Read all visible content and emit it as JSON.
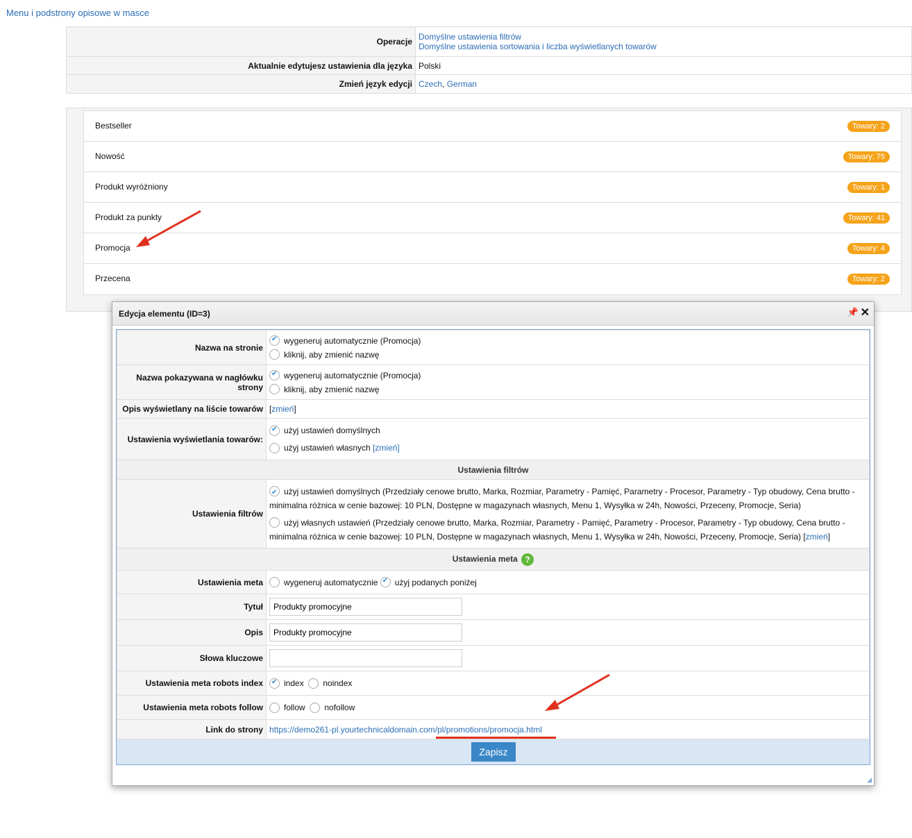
{
  "top_link": "Menu i podstrony opisowe w masce",
  "info": {
    "operations_label": "Operacje",
    "operations_links": [
      "Domyślne ustawienia filtrów",
      "Domyślne ustawienia sortowania i liczba wyświetlanych towarów"
    ],
    "editing_label": "Aktualnie edytujesz ustawienia dla języka",
    "editing_value": "Polski",
    "change_lang_label": "Zmień język edycji",
    "lang_links": [
      "Czech",
      "German"
    ],
    "lang_separator": ", "
  },
  "list": {
    "items": [
      {
        "name": "Bestseller",
        "badge": "Towary: 2"
      },
      {
        "name": "Nowość",
        "badge": "Towary: 75"
      },
      {
        "name": "Produkt wyróżniony",
        "badge": "Towary: 1"
      },
      {
        "name": "Produkt za punkty",
        "badge": "Towary: 41"
      },
      {
        "name": "Promocja",
        "badge": "Towary: 4"
      },
      {
        "name": "Przecena",
        "badge": "Towary: 2"
      }
    ]
  },
  "dialog": {
    "title": "Edycja elementu (ID=3)",
    "rows": {
      "name_label": "Nazwa na stronie",
      "name_auto": "wygeneruj automatycznie (Promocja)",
      "name_click": "kliknij, aby zmienić nazwę",
      "header_label": "Nazwa pokazywana w nagłówku strony",
      "header_auto": "wygeneruj automatycznie (Promocja)",
      "header_click": "kliknij, aby zmienić nazwę",
      "desc_label": "Opis wyświetlany na liście towarów",
      "desc_open": "[",
      "desc_link": "zmień",
      "desc_close": "]",
      "display_label": "Ustawienia wyświetlania towarów:",
      "display_default": "użyj ustawień domyślnych",
      "display_custom": "użyj ustawień własnych",
      "display_custom_link": "[zmień]",
      "filters_section": "Ustawienia filtrów",
      "filters_label": "Ustawienia filtrów",
      "filters_default": "użyj ustawień domyślnych (Przedziały cenowe brutto, Marka, Rozmiar, Parametry - Pamięć, Parametry - Procesor, Parametry - Typ obudowy, Cena brutto - minimalna różnica w cenie bazowej: 10 PLN, Dostępne w magazynach własnych, Menu 1, Wysyłka w 24h, Nowości, Przeceny, Promocje, Seria)",
      "filters_custom": "użyj własnych ustawień (Przedziały cenowe brutto, Marka, Rozmiar, Parametry - Pamięć, Parametry - Procesor, Parametry - Typ obudowy, Cena brutto - minimalna różnica w cenie bazowej: 10 PLN, Dostępne w magazynach własnych, Menu 1, Wysyłka w 24h, Nowości, Przeceny, Promocje, Seria) [",
      "filters_custom_link": "zmień",
      "filters_custom_close": "]",
      "meta_section": "Ustawienia meta",
      "meta_label": "Ustawienia meta",
      "meta_auto": "wygeneruj automatycznie",
      "meta_given": "użyj podanych poniżej",
      "title_label": "Tytuł",
      "title_value": "Produkty promocyjne",
      "desc2_label": "Opis",
      "desc2_value": "Produkty promocyjne",
      "keywords_label": "Słowa kluczowe",
      "keywords_value": "",
      "robots_index_label": "Ustawienia meta robots index",
      "index": "index",
      "noindex": "noindex",
      "robots_follow_label": "Ustawienia meta robots follow",
      "follow": "follow",
      "nofollow": "nofollow",
      "link_label": "Link do strony",
      "link_url": "https://demo261-pl.yourtechnicaldomain.com/pl/promotions/promocja.html"
    },
    "save": "Zapisz"
  },
  "colors": {
    "link": "#2a6db5",
    "badge": "#f5a31a",
    "arrow": "#e0301e",
    "save": "#3a87c8"
  }
}
